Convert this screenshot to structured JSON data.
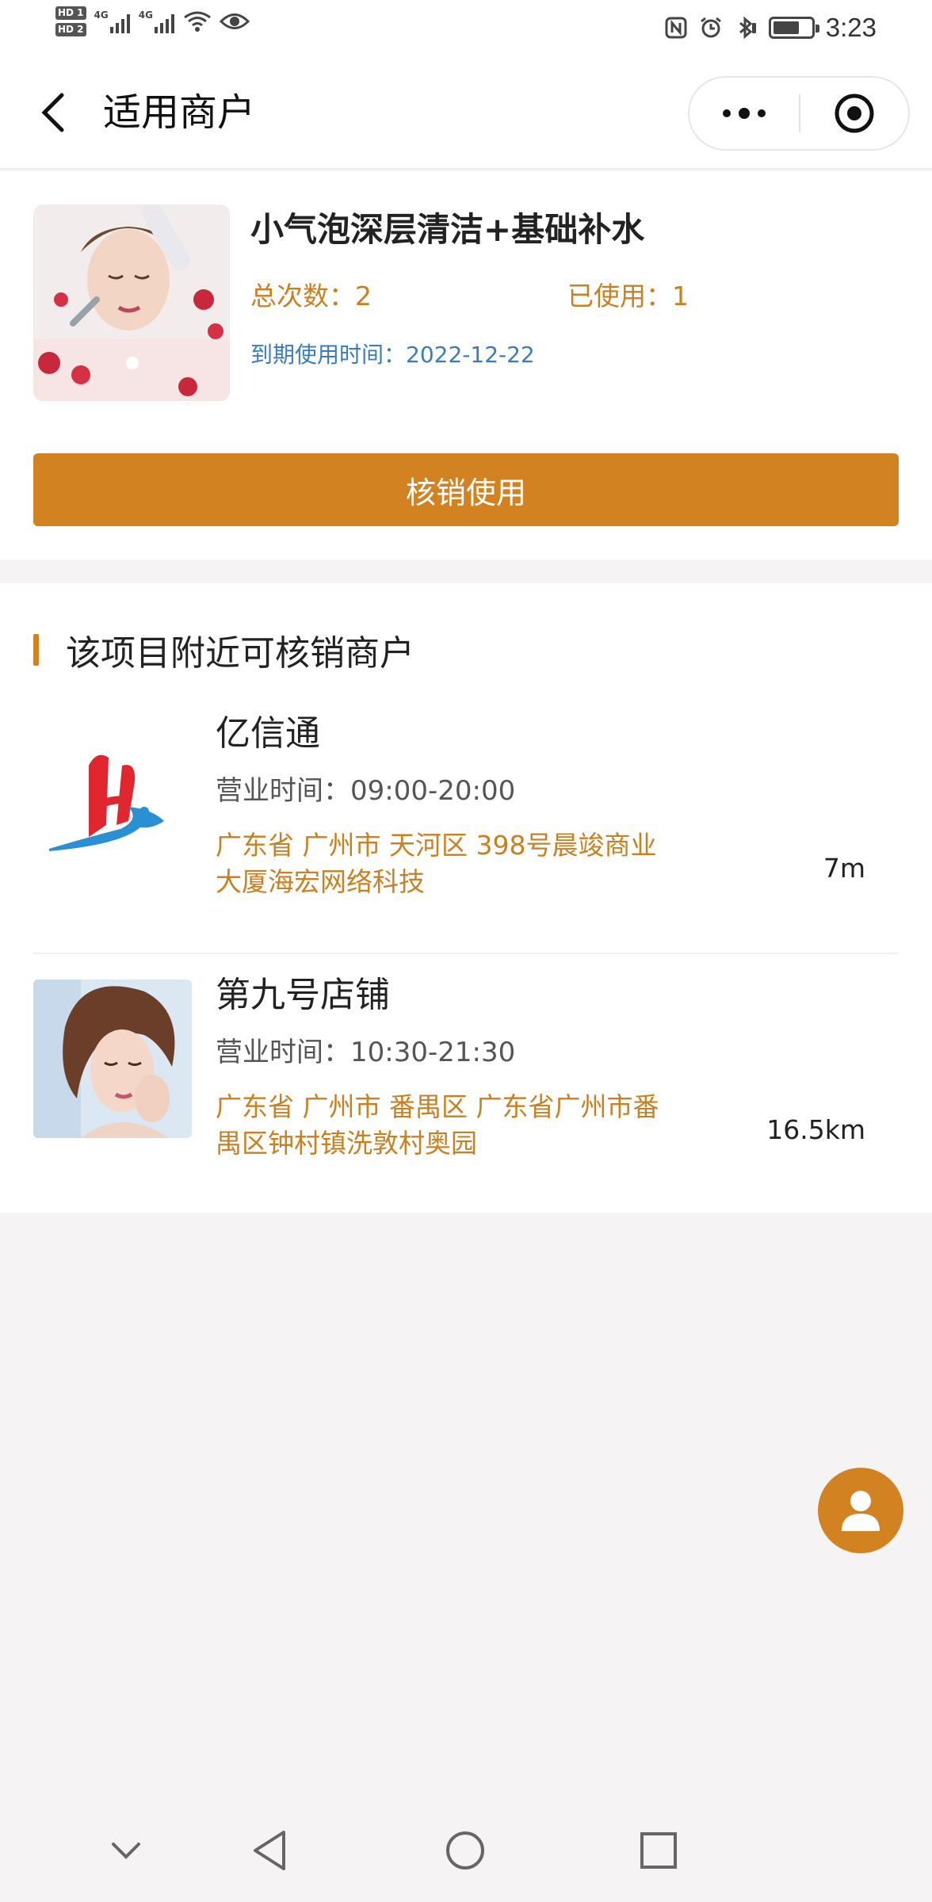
{
  "status_bar": {
    "hd1": "HD 1",
    "hd2": "HD 2",
    "signal1_label": "4G",
    "signal2_label": "4G",
    "time": "3:23",
    "battery_level": 0.7,
    "icons": [
      "nfc-icon",
      "alarm-icon",
      "bluetooth-icon",
      "battery-icon",
      "wifi-icon",
      "eye-icon"
    ]
  },
  "nav": {
    "title": "适用商户",
    "back_icon": "chevron-left-icon",
    "more_icon": "more-dots-icon",
    "close_icon": "mini-program-close-icon"
  },
  "product": {
    "title": "小气泡深层清洁+基础补水",
    "total_label": "总次数：",
    "total_value": "2",
    "used_label": "已使用：",
    "used_value": "1",
    "expire_label": "到期使用时间：",
    "expire_value": "2022-12-22",
    "redeem_label": "核销使用"
  },
  "merchants_section": {
    "title": "该项目附近可核销商户",
    "items": [
      {
        "name": "亿信通",
        "hours_label": "营业时间：",
        "hours": "09:00-20:00",
        "address_line1": "广东省 广州市 天河区 398号晨竣商业",
        "address_line2": "大厦海宏网络科技",
        "distance": "7m",
        "logo": "sail-wave-logo"
      },
      {
        "name": "第九号店铺",
        "hours_label": "营业时间：",
        "hours": "10:30-21:30",
        "address_line1": "广东省 广州市 番禺区 广东省广州市番",
        "address_line2": "禺区钟村镇洗敦村奥园",
        "distance": "16.5km",
        "logo": "store-portrait-photo"
      }
    ]
  },
  "fab": {
    "icon": "user-icon"
  },
  "system_nav": {
    "icons": [
      "collapse-icon",
      "back-triangle-icon",
      "home-circle-icon",
      "recents-square-icon"
    ]
  },
  "colors": {
    "accent": "#d38222",
    "accent_text": "#c98020",
    "link": "#3a7bbd"
  }
}
